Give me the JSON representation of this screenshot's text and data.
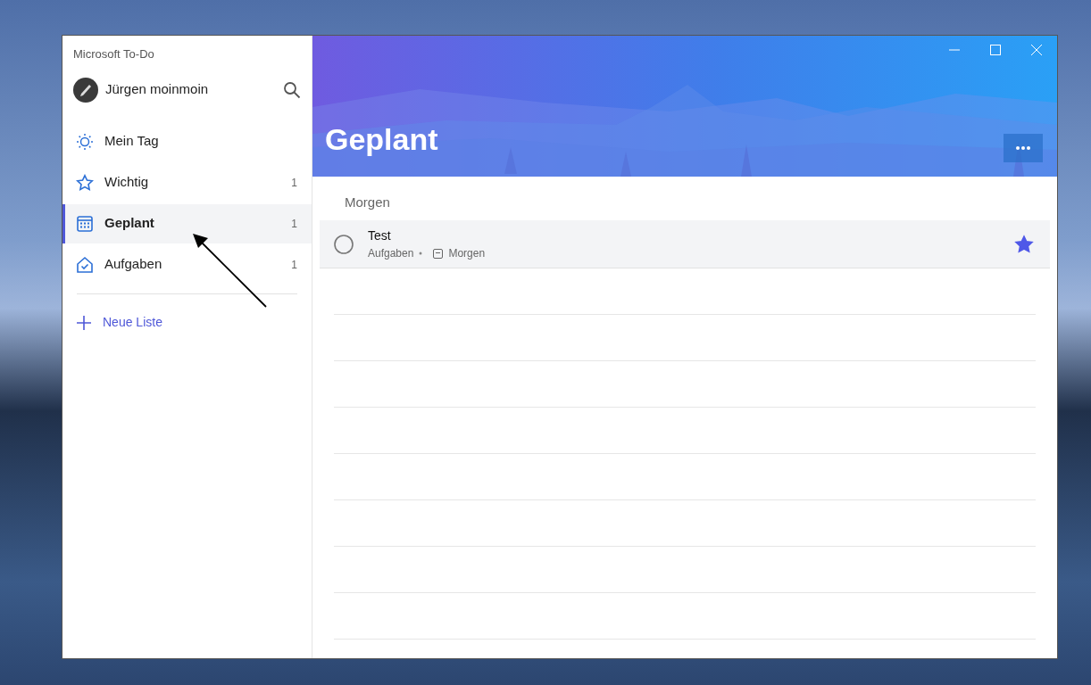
{
  "window": {
    "title": "Microsoft To-Do"
  },
  "user": {
    "name": "Jürgen moinmoin"
  },
  "sidebar": {
    "items": [
      {
        "label": "Mein Tag",
        "selected": false
      },
      {
        "label": "Wichtig",
        "count": "1",
        "selected": false
      },
      {
        "label": "Geplant",
        "count": "1",
        "selected": true
      },
      {
        "label": "Aufgaben",
        "count": "1",
        "selected": false
      }
    ]
  },
  "new_list": {
    "label": "Neue Liste"
  },
  "list": {
    "title": "Geplant",
    "groups": [
      {
        "heading": "Morgen",
        "tasks": [
          {
            "title": "Test",
            "completed": false,
            "important": true,
            "list": "Aufgaben",
            "due": "Morgen"
          }
        ]
      }
    ]
  }
}
